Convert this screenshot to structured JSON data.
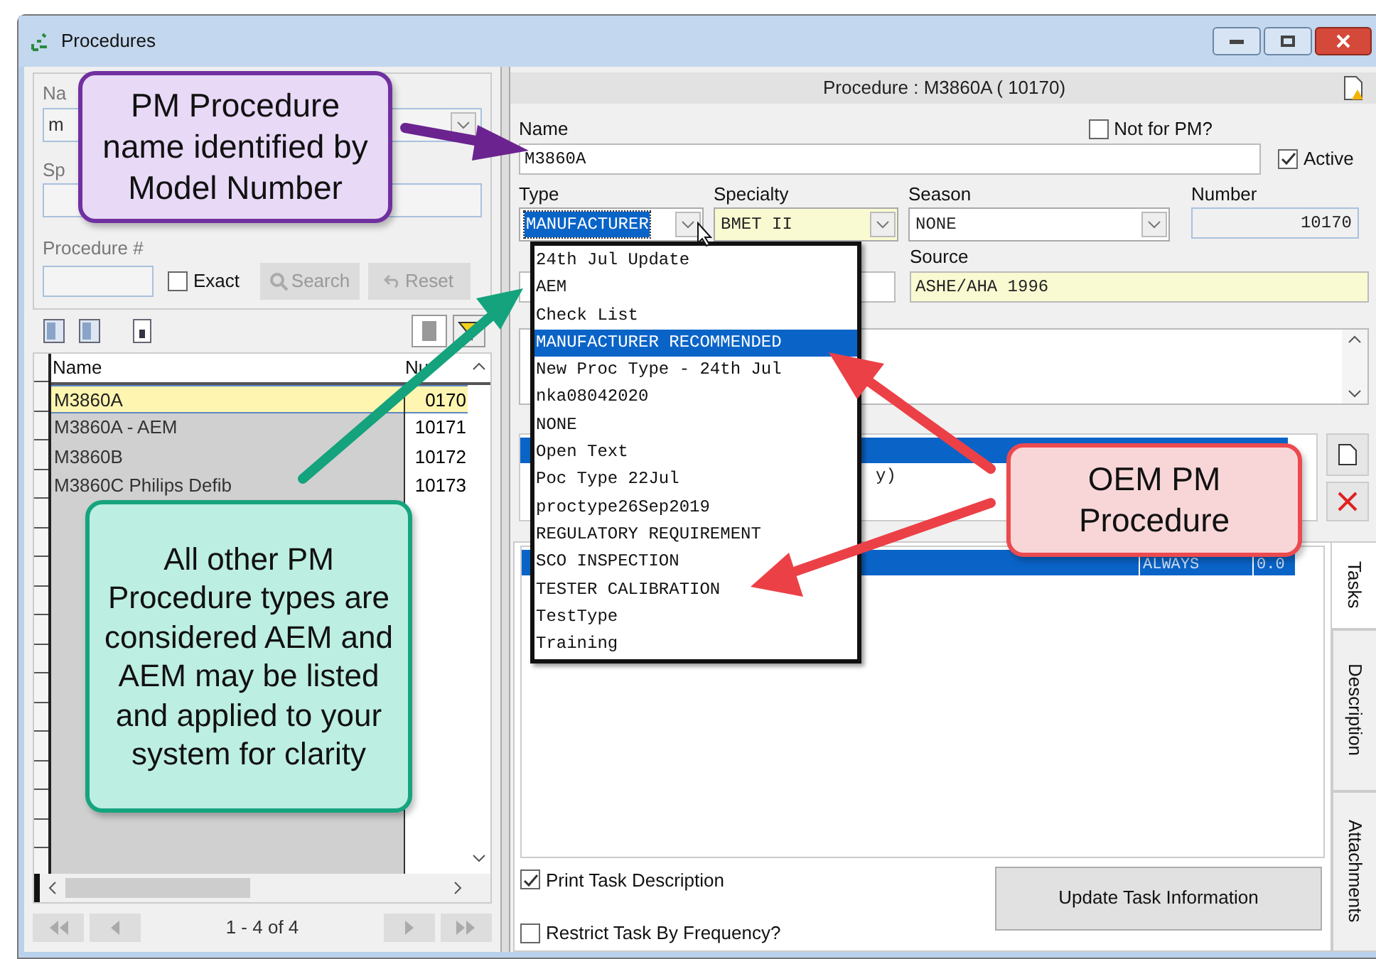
{
  "window": {
    "title": "Procedures"
  },
  "search_panel": {
    "name_label": "Na",
    "name_value": "m",
    "specialty_label": "Sp",
    "procedure_label": "Procedure #",
    "exact": {
      "label": "Exact",
      "checked": false
    },
    "search_button": "Search",
    "reset_button": "Reset"
  },
  "grid": {
    "columns": [
      "Name",
      "Nu"
    ],
    "rows": [
      {
        "name": "M3860A",
        "number": "0170",
        "selected": true
      },
      {
        "name": "M3860A - AEM",
        "number": "10171",
        "selected": false
      },
      {
        "name": "M3860B",
        "number": "10172",
        "selected": false
      },
      {
        "name": "M3860C Philips Defib",
        "number": "10173",
        "selected": false
      }
    ],
    "pager": "1 - 4 of 4"
  },
  "detail": {
    "header": "Procedure : M3860A ( 10170)",
    "name_label": "Name",
    "name_value": "M3860A",
    "not_for_pm": {
      "label": "Not for PM?",
      "checked": false
    },
    "active": {
      "label": "Active",
      "checked": true
    },
    "combos": [
      {
        "label": "Type",
        "value": "MANUFACTURER",
        "kind": "combo",
        "highlighted": true,
        "required": false
      },
      {
        "label": "Specialty",
        "value": "BMET II",
        "kind": "combo",
        "highlighted": false,
        "required": true
      },
      {
        "label": "Season",
        "value": "NONE",
        "kind": "combo",
        "highlighted": false,
        "required": false
      },
      {
        "label": "Number",
        "value": "10170",
        "kind": "number",
        "highlighted": false,
        "required": false
      }
    ],
    "source_label": "Source",
    "source_value": "ASHE/AHA 1996",
    "source_required": true,
    "frequency_row": "y)",
    "task_row": [
      "ALWAYS",
      "0.0"
    ],
    "options": [
      {
        "label": "Print Task Description",
        "checked": true
      },
      {
        "label": "Restrict Task By Frequency?",
        "checked": false
      }
    ],
    "update_button": "Update Task Information",
    "side_tabs": [
      {
        "label": "Tasks",
        "selected": true
      },
      {
        "label": "Description",
        "selected": false
      },
      {
        "label": "Attachments",
        "selected": false
      }
    ]
  },
  "type_dropdown": [
    {
      "label": "24th Jul Update",
      "selected": false
    },
    {
      "label": "AEM",
      "selected": false
    },
    {
      "label": "Check List",
      "selected": false
    },
    {
      "label": "MANUFACTURER RECOMMENDED",
      "selected": true
    },
    {
      "label": "New Proc Type - 24th Jul",
      "selected": false
    },
    {
      "label": "nka08042020",
      "selected": false
    },
    {
      "label": "NONE",
      "selected": false
    },
    {
      "label": "Open Text",
      "selected": false
    },
    {
      "label": "Poc Type 22Jul",
      "selected": false
    },
    {
      "label": "proctype26Sep2019",
      "selected": false
    },
    {
      "label": "REGULATORY REQUIREMENT",
      "selected": false
    },
    {
      "label": "SCO INSPECTION",
      "selected": false
    },
    {
      "label": "TESTER CALIBRATION",
      "selected": false
    },
    {
      "label": "TestType",
      "selected": false
    },
    {
      "label": "Training",
      "selected": false
    }
  ],
  "callouts": [
    {
      "text": "PM Procedure name identified by Model Number",
      "kind": "purple"
    },
    {
      "text": "All other PM Procedure types are considered AEM and AEM may be listed and applied to your system for clarity",
      "kind": "green"
    },
    {
      "text": "OEM PM Procedure",
      "kind": "red"
    }
  ]
}
